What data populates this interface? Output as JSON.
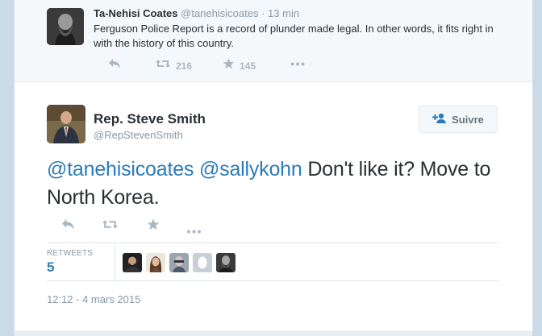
{
  "parent_tweet": {
    "name": "Ta-Nehisi Coates",
    "handle": "@tanehisicoates",
    "separator": "·",
    "time": "13 min",
    "text": "Ferguson Police Report is a record of plunder made legal. In other words, it fits right in with the history of this country.",
    "retweet_count": "216",
    "favorite_count": "145"
  },
  "main_tweet": {
    "name": "Rep. Steve Smith",
    "handle": "@RepStevenSmith",
    "follow_label": "Suivre",
    "mention_1": "@tanehisicoates",
    "mention_2": "@sallykohn",
    "text": " Don't like it? Move to North Korea.",
    "retweets_label": "RETWEETS",
    "retweets_count": "5",
    "timestamp": "12:12 - 4 mars 2015"
  },
  "icons": {
    "reply": "reply-icon",
    "retweet": "retweet-icon",
    "favorite": "star-icon",
    "more": "more-icon",
    "follow": "add-user-icon"
  },
  "colors": {
    "link": "#2b7bb9",
    "muted": "#8899a6",
    "icon": "#aab8c2",
    "background": "#c9dbe8"
  }
}
